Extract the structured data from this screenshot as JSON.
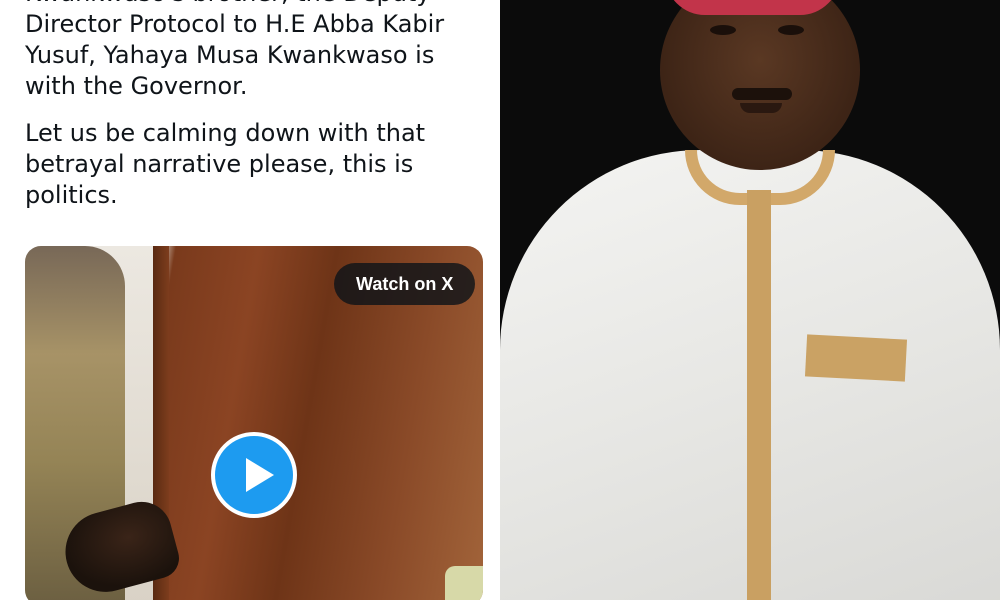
{
  "tweet": {
    "text_paragraphs": [
      "Kwankwaso's brother, the Deputy\nDirector Protocol to H.E Abba Kabir\nYusuf, Yahaya Musa Kwankwaso is\nwith the Governor.",
      "Let us be calming down with that\nbetrayal narrative please, this is\npolitics."
    ]
  },
  "video": {
    "badge_label": "Watch on X",
    "play_icon": "play-icon"
  },
  "colors": {
    "play_button": "#1d9bf0",
    "text": "#0f1419",
    "photo_background": "#0b0b0b"
  }
}
